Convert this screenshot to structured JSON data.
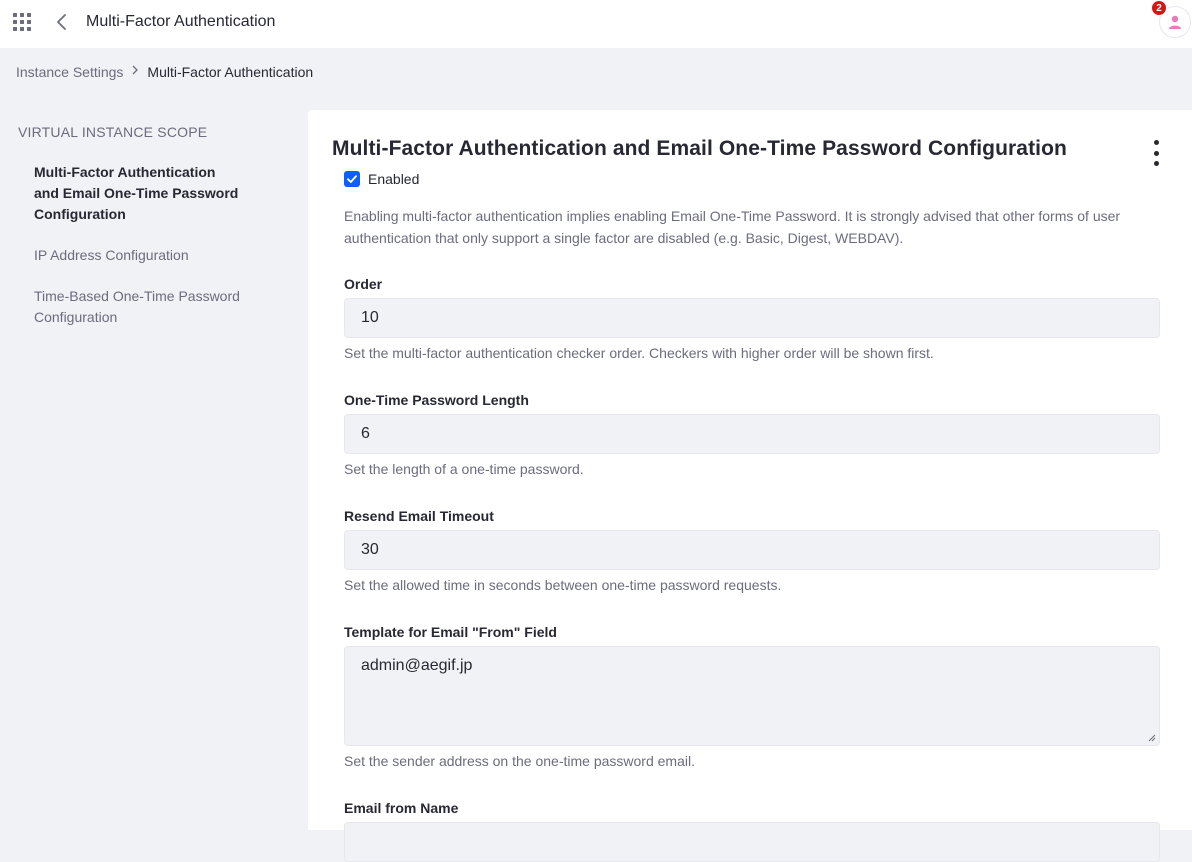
{
  "topbar": {
    "title": "Multi-Factor Authentication",
    "notification_count": "2"
  },
  "breadcrumb": {
    "items": [
      "Instance Settings",
      "Multi-Factor Authentication"
    ]
  },
  "sidebar": {
    "heading": "VIRTUAL INSTANCE SCOPE",
    "items": [
      {
        "label": "Multi-Factor Authentication and Email One-Time Password Configuration",
        "active": true
      },
      {
        "label": "IP Address Configuration",
        "active": false
      },
      {
        "label": "Time-Based One-Time Password Configuration",
        "active": false
      }
    ]
  },
  "main": {
    "title": "Multi-Factor Authentication and Email One-Time Password Configuration",
    "enabled_label": "Enabled",
    "enabled_checked": true,
    "intro": "Enabling multi-factor authentication implies enabling Email One-Time Password. It is strongly advised that other forms of user authentication that only support a single factor are disabled (e.g. Basic, Digest, WEBDAV).",
    "fields": [
      {
        "label": "Order",
        "value": "10",
        "help": "Set the multi-factor authentication checker order. Checkers with higher order will be shown first."
      },
      {
        "label": "One-Time Password Length",
        "value": "6",
        "help": "Set the length of a one-time password."
      },
      {
        "label": "Resend Email Timeout",
        "value": "30",
        "help": "Set the allowed time in seconds between one-time password requests."
      },
      {
        "label": "Template for Email \"From\" Field",
        "value": "admin@aegif.jp",
        "help": "Set the sender address on the one-time password email."
      },
      {
        "label": "Email from Name",
        "value": "",
        "help": ""
      }
    ]
  },
  "colors": {
    "accent": "#0b5fff",
    "badge": "#da1414",
    "avatar": "#e97bbd"
  },
  "icons": {
    "apps": "apps-grid-icon",
    "back": "chevron-left-icon",
    "avatar": "user-icon",
    "kebab": "vertical-ellipsis-icon",
    "check": "check-icon"
  }
}
